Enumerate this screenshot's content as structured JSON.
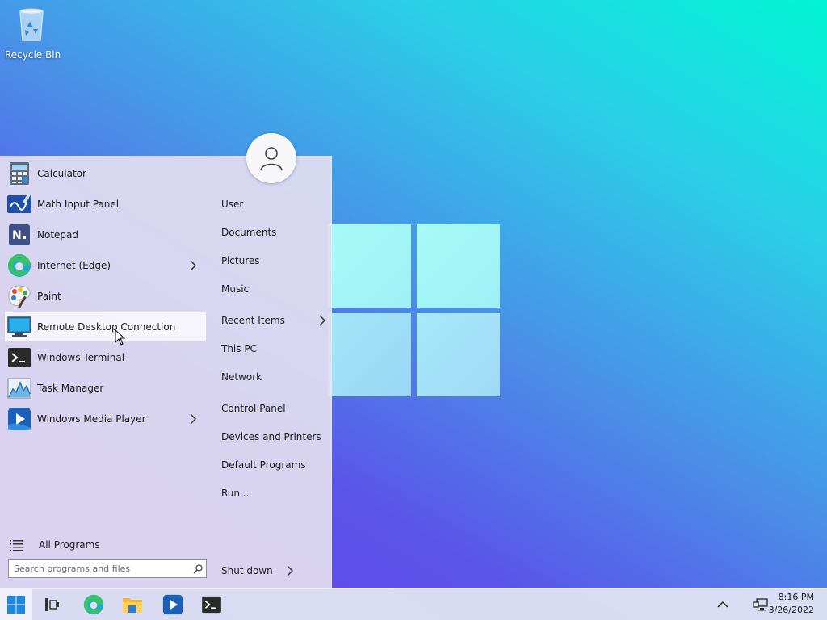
{
  "desktop": {
    "icons": [
      {
        "label": "Recycle Bin",
        "icon": "recycle-bin-icon"
      }
    ]
  },
  "start_menu": {
    "apps": [
      {
        "label": "Calculator",
        "icon": "calculator-icon",
        "submenu": false
      },
      {
        "label": "Math Input Panel",
        "icon": "math-input-icon",
        "submenu": false
      },
      {
        "label": "Notepad",
        "icon": "notepad-icon",
        "submenu": false
      },
      {
        "label": "Internet (Edge)",
        "icon": "edge-icon",
        "submenu": true
      },
      {
        "label": "Paint",
        "icon": "paint-icon",
        "submenu": false
      },
      {
        "label": "Remote Desktop Connection",
        "icon": "remote-desktop-icon",
        "submenu": false,
        "hovered": true
      },
      {
        "label": "Windows Terminal",
        "icon": "terminal-icon",
        "submenu": false
      },
      {
        "label": "Task Manager",
        "icon": "task-manager-icon",
        "submenu": false
      },
      {
        "label": "Windows Media Player",
        "icon": "media-player-icon",
        "submenu": true
      }
    ],
    "all_programs_label": "All Programs",
    "search_placeholder": "Search programs and files",
    "places": [
      {
        "label": "User",
        "submenu": false
      },
      {
        "label": "Documents",
        "submenu": false
      },
      {
        "label": "Pictures",
        "submenu": false
      },
      {
        "label": "Music",
        "submenu": false
      },
      {
        "label": "Recent Items",
        "submenu": true
      },
      {
        "label": "This PC",
        "submenu": false
      },
      {
        "label": "Network",
        "submenu": false
      },
      {
        "label": "Control Panel",
        "submenu": false
      },
      {
        "label": "Devices and Printers",
        "submenu": false
      },
      {
        "label": "Default Programs",
        "submenu": false
      },
      {
        "label": "Run...",
        "submenu": false
      }
    ],
    "shutdown_label": "Shut down"
  },
  "taskbar": {
    "pinned": [
      "start-icon",
      "task-view-icon",
      "edge-icon",
      "file-explorer-icon",
      "media-player-icon",
      "terminal-icon"
    ],
    "time": "8:16 PM",
    "date": "3/26/2022"
  },
  "colors": {
    "accent": "#0078d4",
    "menu_bg": "#e2def0"
  }
}
